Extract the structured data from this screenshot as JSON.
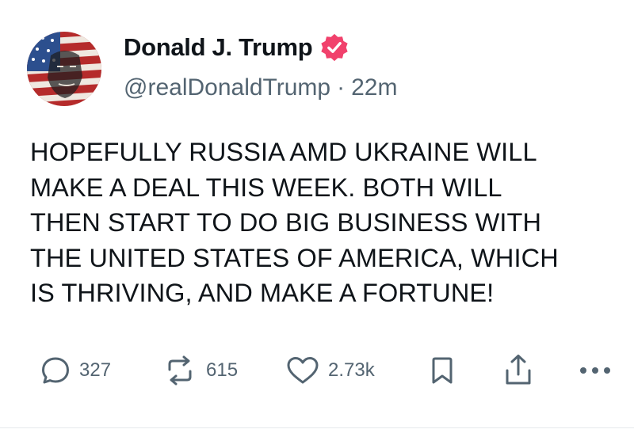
{
  "post": {
    "author": {
      "display_name": "Donald J. Trump",
      "handle": "@realDonaldTrump",
      "separator": "·",
      "time_ago": "22m",
      "verified": true,
      "avatar_icon": "flag-portrait-avatar",
      "verified_icon": "verified-badge-icon"
    },
    "text": "HOPEFULLY RUSSIA AMD UKRAINE WILL\nMAKE A DEAL THIS WEEK. BOTH WILL\nTHEN START TO DO BIG BUSINESS WITH\nTHE UNITED STATES OF AMERICA, WHICH\nIS THRIVING, AND MAKE A FORTUNE!",
    "actions": {
      "replies": {
        "icon": "reply-icon",
        "count": "327"
      },
      "reposts": {
        "icon": "repost-icon",
        "count": "615"
      },
      "likes": {
        "icon": "heart-icon",
        "count": "2.73k"
      },
      "bookmark": {
        "icon": "bookmark-icon"
      },
      "share": {
        "icon": "share-icon"
      },
      "more": {
        "icon": "more-icon"
      }
    }
  },
  "colors": {
    "text_primary": "#0f1419",
    "text_secondary": "#536471",
    "verified_badge": "#f1416c",
    "background": "#ffffff"
  }
}
